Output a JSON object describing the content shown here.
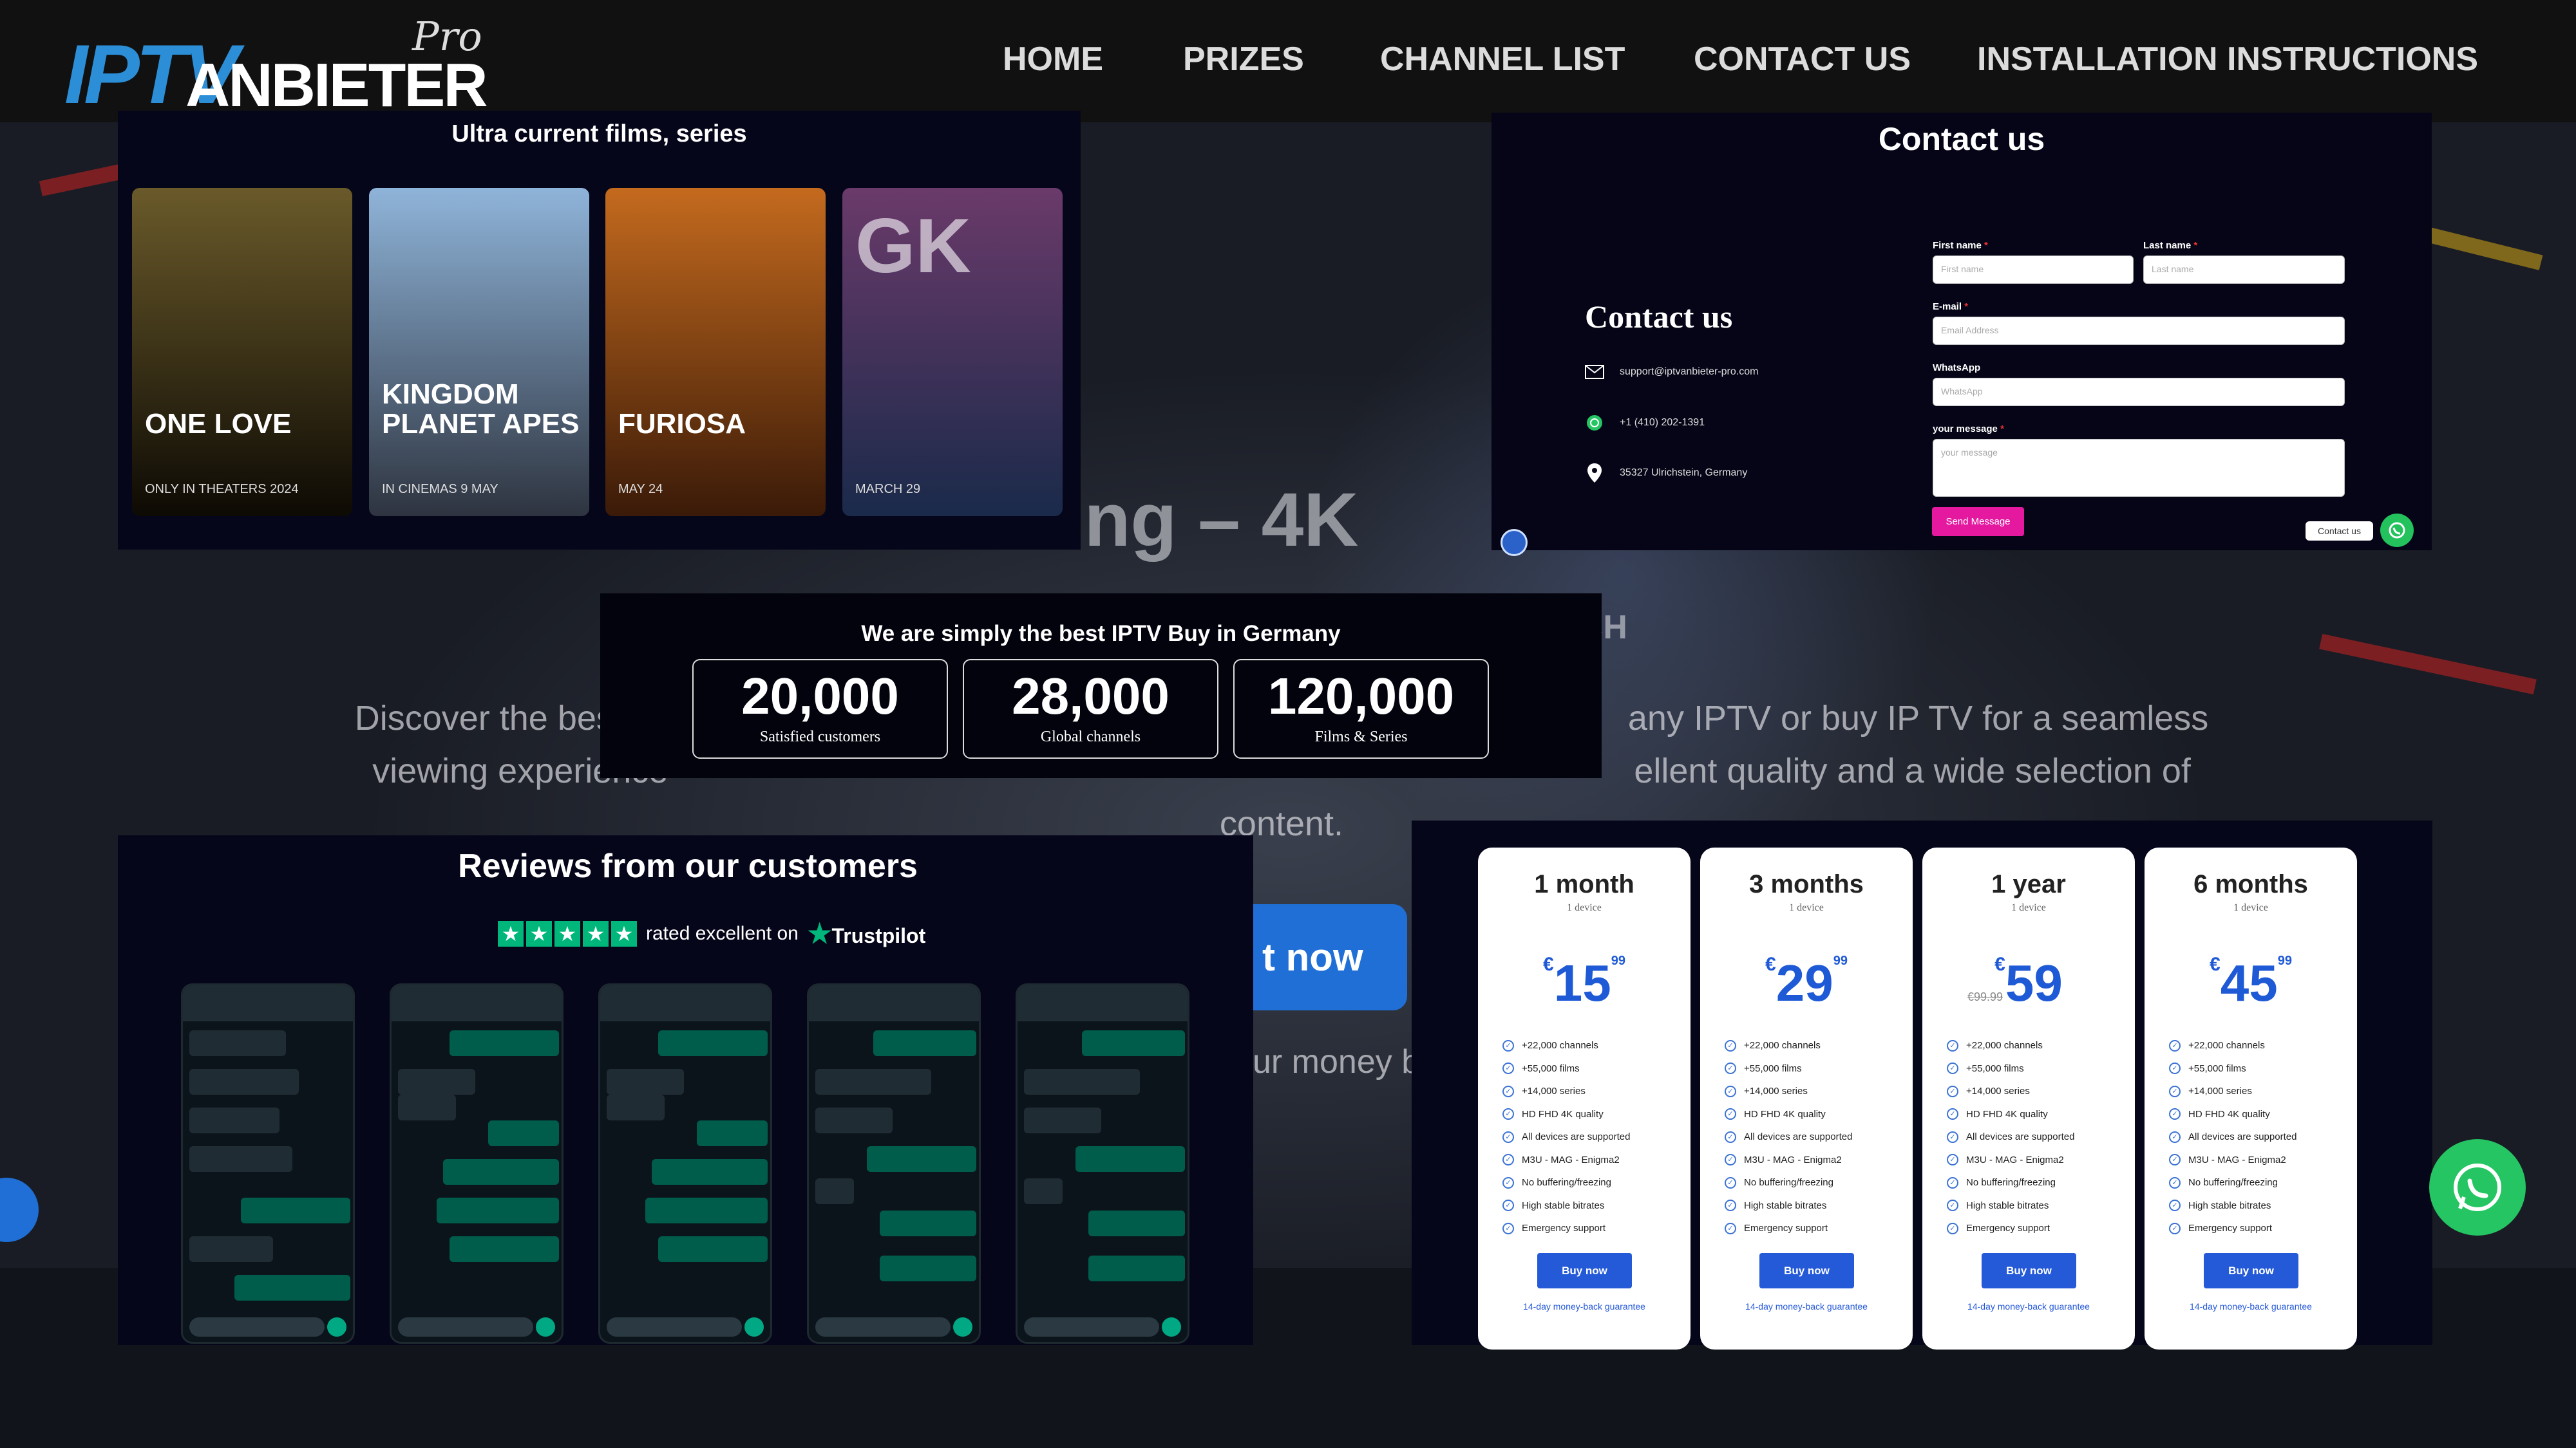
{
  "nav": {
    "logo_ip": "IP",
    "logo_tv": "TV",
    "logo_rest": "ANBIETER",
    "logo_pro": "Pro",
    "items": [
      "HOME",
      "PRIZES",
      "CHANNEL LIST",
      "CONTACT US",
      "INSTALLATION INSTRUCTIONS"
    ]
  },
  "hero": {
    "title": "aming – 4K",
    "subtitle": "TCH",
    "text_line1_a": "Discover the best",
    "text_line1_b": "any IPTV or buy IP TV for a seamless",
    "text_line2_a": "viewing experience",
    "text_line2_b": "ellent quality and a wide selection of",
    "text_line3": "content.",
    "button": "t now",
    "money": "ur money b"
  },
  "films": {
    "title": "Ultra current films, series",
    "posters": [
      {
        "title": "ONE LOVE",
        "date": "ONLY IN THEATERS 2024",
        "top": "#6a5a2a",
        "bottom": "#0d0a04"
      },
      {
        "title": "KINGDOM PLANET APES",
        "date": "IN CINEMAS 9 MAY",
        "top": "#8fb4d9",
        "bottom": "#2e3440"
      },
      {
        "title": "FURIOSA",
        "date": "MAY 24",
        "top": "#c46a1e",
        "bottom": "#3a1a08"
      },
      {
        "title": "GK",
        "date": "MARCH 29",
        "top": "#6a3a6a",
        "bottom": "#1a2a4a"
      }
    ]
  },
  "contact": {
    "heading": "Contact us",
    "sub_heading": "Contact us",
    "email": "support@iptvanbieter-pro.com",
    "phone": "+1 (410) 202-1391",
    "address": "35327 Ulrichstein, Germany",
    "first_name_label": "First name",
    "first_name_placeholder": "First name",
    "last_name_label": "Last name",
    "last_name_placeholder": "Last name",
    "email_label": "E-mail",
    "email_placeholder": "Email Address",
    "whatsapp_label": "WhatsApp",
    "whatsapp_placeholder": "WhatsApp",
    "message_label": "your message",
    "message_placeholder": "your message",
    "send_button": "Send Message",
    "chip": "Contact us"
  },
  "stats": {
    "title": "We are simply the best IPTV Buy in Germany",
    "items": [
      {
        "value": "20,000",
        "label": "Satisfied customers"
      },
      {
        "value": "28,000",
        "label": "Global channels"
      },
      {
        "value": "120,000",
        "label": "Films & Series"
      }
    ]
  },
  "reviews": {
    "title": "Reviews from our customers",
    "rated": "rated excellent on",
    "trustpilot": "Trustpilot",
    "stars": 5
  },
  "pricing": {
    "features": [
      "+22,000 channels",
      "+55,000 films",
      "+14,000 series",
      "HD FHD 4K quality",
      "All devices are supported",
      "M3U - MAG - Enigma2",
      "No buffering/freezing",
      "High stable bitrates",
      "Emergency support"
    ],
    "buy_label": "Buy now",
    "guarantee": "14-day money-back guarantee",
    "plans": [
      {
        "name": "1 month",
        "devices": "1 device",
        "currency": "€",
        "amount": "15",
        "cents": "99",
        "old": ""
      },
      {
        "name": "3 months",
        "devices": "1 device",
        "currency": "€",
        "amount": "29",
        "cents": "99",
        "old": ""
      },
      {
        "name": "1 year",
        "devices": "1 device",
        "currency": "€",
        "amount": "59",
        "cents": "",
        "old": "€99.99"
      },
      {
        "name": "6 months",
        "devices": "1 device",
        "currency": "€",
        "amount": "45",
        "cents": "99",
        "old": ""
      }
    ]
  },
  "colors": {
    "accent_blue": "#2459d8",
    "whatsapp_green": "#25c563",
    "send_pink": "#e4199f",
    "trustpilot_green": "#00b67a"
  }
}
